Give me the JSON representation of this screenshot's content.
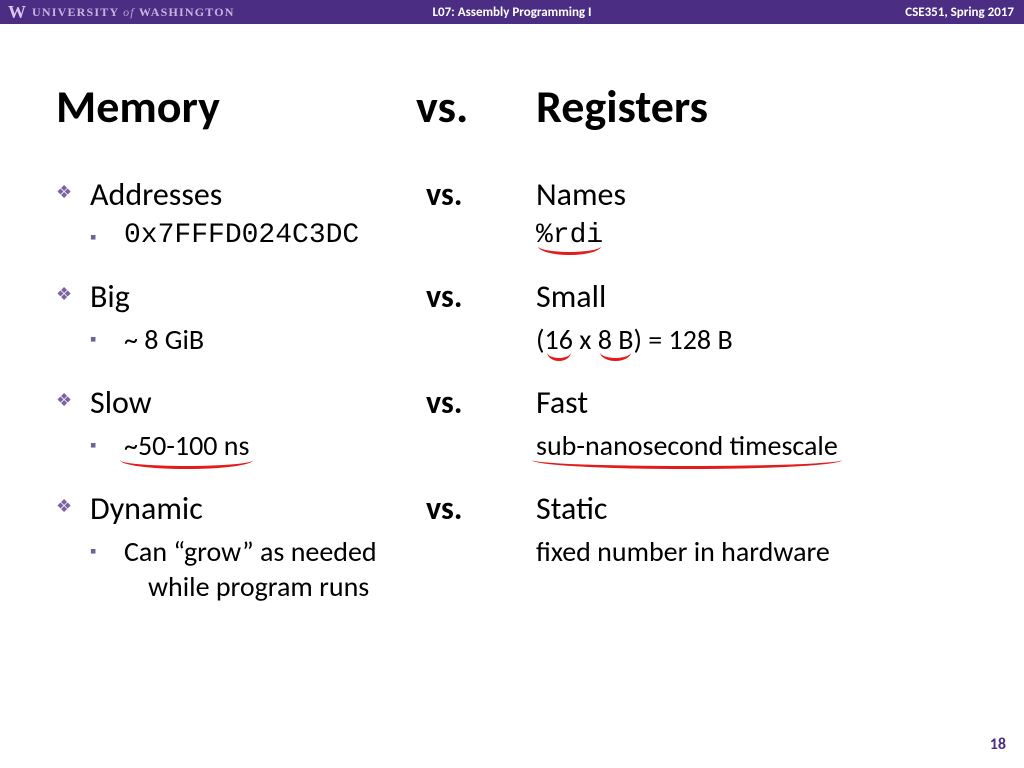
{
  "header": {
    "university_w": "W",
    "university_main": "UNIVERSITY",
    "university_of": "of",
    "university_name": "WASHINGTON",
    "lecture": "L07: Assembly Programming I",
    "course": "CSE351, Spring 2017"
  },
  "title": {
    "left": "Memory",
    "mid": "vs.",
    "right": "Registers"
  },
  "rows": [
    {
      "left": "Addresses",
      "mid": "vs.",
      "right": "Names",
      "sub_left": "0x7FFFD024C3DC",
      "sub_right": "%rdi",
      "sub_left_mono": true,
      "sub_right_mono": true
    },
    {
      "left": "Big",
      "mid": "vs.",
      "right": "Small",
      "sub_left": "~ 8 GiB",
      "sub_right_prefix": "(",
      "sub_right_u1": "16",
      "sub_right_mid": " x ",
      "sub_right_u2": "8 B",
      "sub_right_suffix": ") = 128 B"
    },
    {
      "left": "Slow",
      "mid": "vs.",
      "right": "Fast",
      "sub_left_u": "~50-100 ns",
      "sub_right_u": "sub-nanosecond timescale"
    },
    {
      "left": "Dynamic",
      "mid": "vs.",
      "right": "Static",
      "sub_left_line1": "Can “grow” as needed",
      "sub_left_line2": "while program runs",
      "sub_right": "fixed number in hardware"
    }
  ],
  "page_number": "18"
}
